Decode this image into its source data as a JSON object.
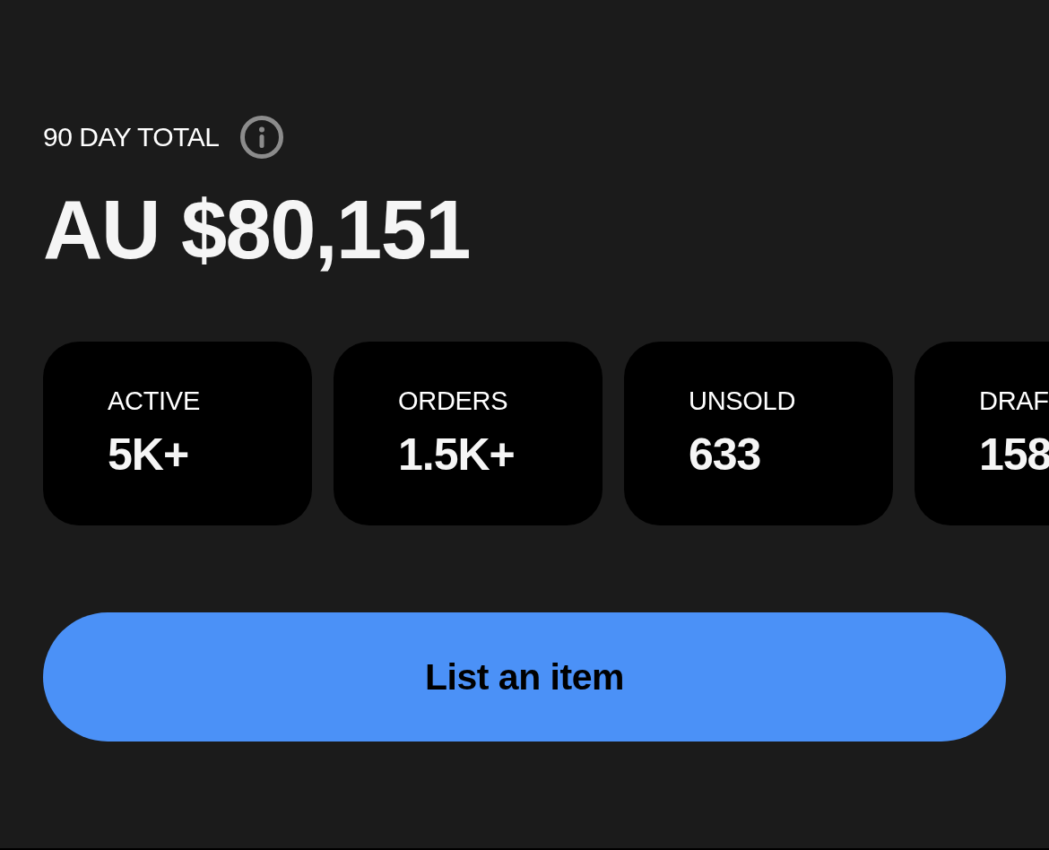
{
  "summary": {
    "label": "90 DAY TOTAL",
    "total": "AU $80,151"
  },
  "stats": [
    {
      "label": "ACTIVE",
      "value": "5K+"
    },
    {
      "label": "ORDERS",
      "value": "1.5K+"
    },
    {
      "label": "UNSOLD",
      "value": "633"
    },
    {
      "label": "DRAF",
      "value": "158"
    }
  ],
  "primary_button": {
    "label": "List an item"
  }
}
